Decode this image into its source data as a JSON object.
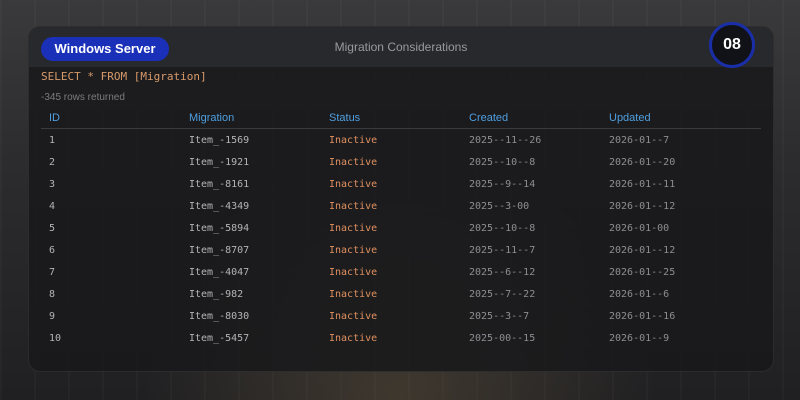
{
  "window": {
    "app_name": "Windows Server",
    "title": "Migration Considerations",
    "badge": "08"
  },
  "query": {
    "sql": "SELECT * FROM [Migration]",
    "row_count": "-345 rows returned"
  },
  "table": {
    "columns": [
      "ID",
      "Migration",
      "Status",
      "Created",
      "Updated"
    ],
    "rows": [
      [
        "1",
        "Item_-1569",
        "Inactive",
        "2025--11--26",
        "2026-01--7"
      ],
      [
        "2",
        "Item_-1921",
        "Inactive",
        "2025--10--8",
        "2026-01--20"
      ],
      [
        "3",
        "Item_-8161",
        "Inactive",
        "2025--9--14",
        "2026-01--11"
      ],
      [
        "4",
        "Item_-4349",
        "Inactive",
        "2025--3-00",
        "2026-01--12"
      ],
      [
        "5",
        "Item_-5894",
        "Inactive",
        "2025--10--8",
        "2026-01-00"
      ],
      [
        "6",
        "Item_-8707",
        "Inactive",
        "2025--11--7",
        "2026-01--12"
      ],
      [
        "7",
        "Item_-4047",
        "Inactive",
        "2025--6--12",
        "2026-01--25"
      ],
      [
        "8",
        "Item_-982",
        "Inactive",
        "2025--7--22",
        "2026-01--6"
      ],
      [
        "9",
        "Item_-8030",
        "Inactive",
        "2025--3--7",
        "2026-01--16"
      ],
      [
        "10",
        "Item_-5457",
        "Inactive",
        "2025-00--15",
        "2026-01--9"
      ]
    ]
  },
  "colors": {
    "accent": "#1a30b8",
    "header_text": "#4f9fe0",
    "status_text": "#e09060",
    "query_text": "#d89a6a"
  }
}
